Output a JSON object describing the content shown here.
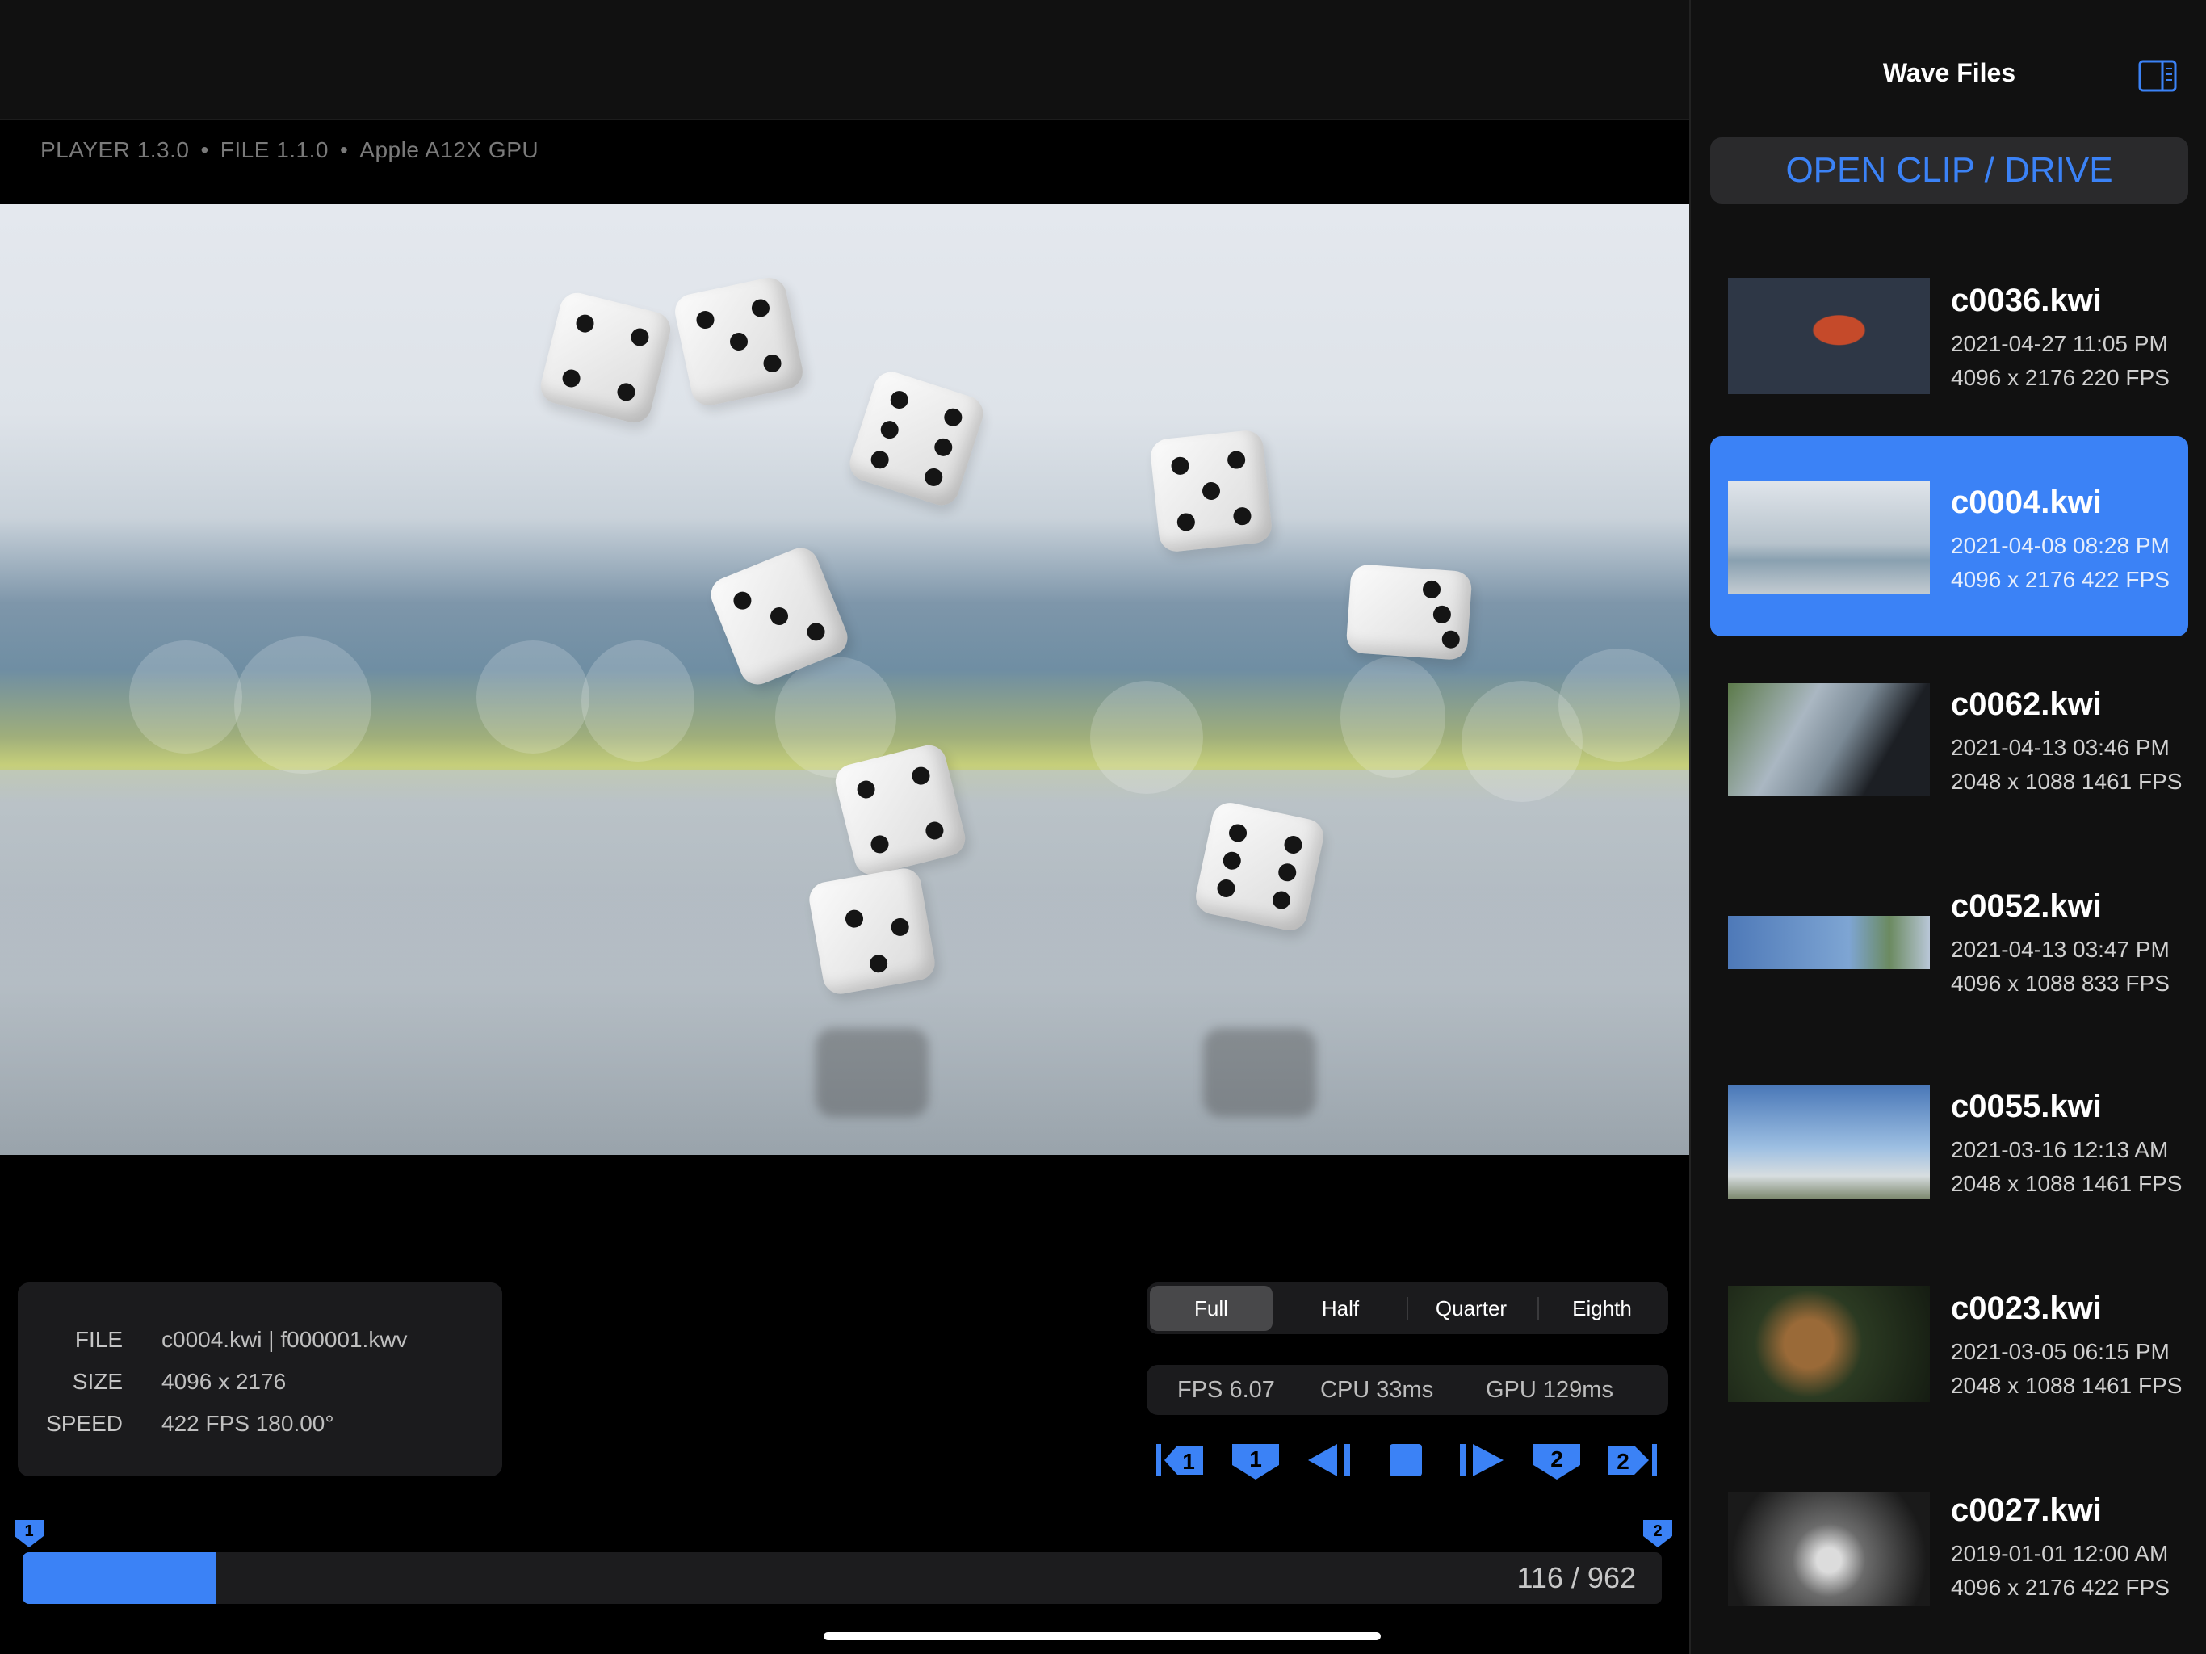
{
  "version_bar": {
    "player": "PLAYER 1.3.0",
    "file": "FILE 1.1.0",
    "gpu": "Apple A12X GPU"
  },
  "file_info": {
    "file_label": "FILE",
    "file_value": "c0004.kwi | f000001.kwv",
    "size_label": "SIZE",
    "size_value": "4096 x 2176",
    "speed_label": "SPEED",
    "speed_value": "422 FPS 180.00°"
  },
  "resolution": {
    "options": [
      "Full",
      "Half",
      "Quarter",
      "Eighth"
    ],
    "selected": "Full"
  },
  "stats": {
    "fps": "FPS  6.07",
    "cpu": "CPU  33ms",
    "gpu": "GPU  129ms"
  },
  "transport": {
    "buttons": [
      "go-to-marker-1",
      "set-marker-1",
      "step-back",
      "stop",
      "step-forward",
      "set-marker-2",
      "go-to-marker-2"
    ],
    "marker1_label": "1",
    "marker2_label": "2"
  },
  "timeline": {
    "current_frame": 116,
    "total_frames": 962,
    "progress_text": "116 / 962",
    "fill_fraction": 0.118
  },
  "sidebar": {
    "title": "Wave Files",
    "toggle_icon": "sidebar-toggle-icon",
    "open_button": "OPEN CLIP / DRIVE",
    "clips": [
      {
        "name": "c0036.kwi",
        "date": "2021-04-27 11:05 PM",
        "meta": "4096 x 2176  220 FPS",
        "selected": false,
        "thumb": "water-balloon"
      },
      {
        "name": "c0004.kwi",
        "date": "2021-04-08 08:28 PM",
        "meta": "4096 x 2176  422 FPS",
        "selected": true,
        "thumb": "dice"
      },
      {
        "name": "c0062.kwi",
        "date": "2021-04-13 03:46 PM",
        "meta": "2048 x 1088  1461 FPS",
        "selected": false,
        "thumb": "cards"
      },
      {
        "name": "c0052.kwi",
        "date": "2021-04-13 03:47 PM",
        "meta": "4096 x 1088  833 FPS",
        "selected": false,
        "thumb": "hummingbird-wide"
      },
      {
        "name": "c0055.kwi",
        "date": "2021-03-16 12:13 AM",
        "meta": "2048 x 1088  1461 FPS",
        "selected": false,
        "thumb": "hummingbird"
      },
      {
        "name": "c0023.kwi",
        "date": "2021-03-05 06:15 PM",
        "meta": "2048 x 1088  1461 FPS",
        "selected": false,
        "thumb": "bees"
      },
      {
        "name": "c0027.kwi",
        "date": "2019-01-01 12:00 AM",
        "meta": "4096 x 2176  422 FPS",
        "selected": false,
        "thumb": "machine"
      }
    ]
  },
  "colors": {
    "accent": "#3b82f6",
    "panel": "#1b1b1d",
    "background": "#000000"
  }
}
